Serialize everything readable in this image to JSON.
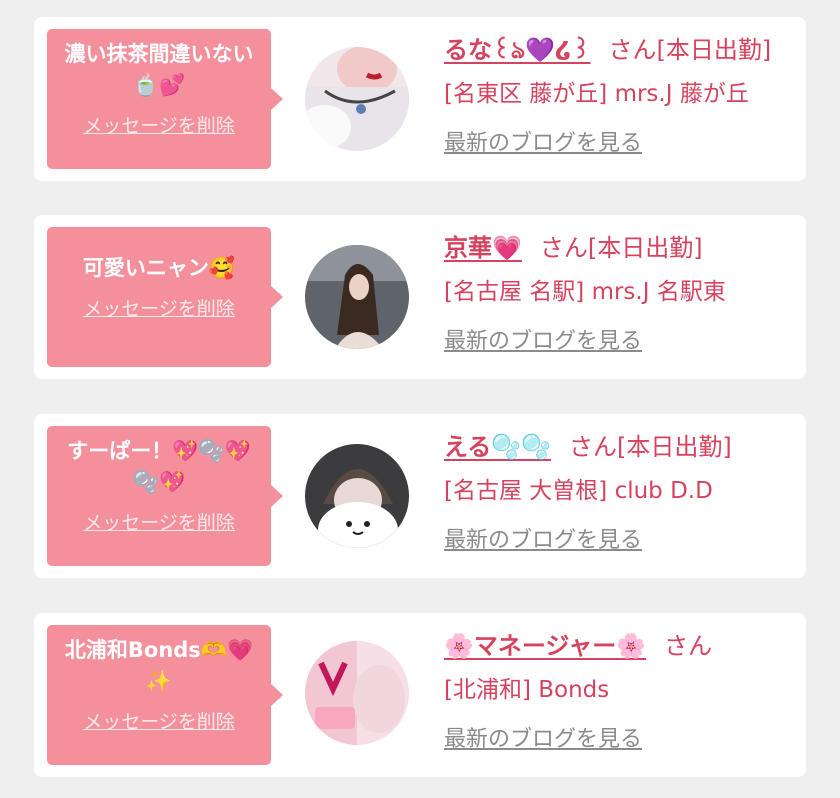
{
  "cards": [
    {
      "message": "濃い抹茶間違いない🍵💕",
      "delete_label": "メッセージを削除",
      "name": "るな꒰ঌ💜໒꒱",
      "honorific": "さん",
      "status": "[本日出勤]",
      "shop": "[名東区 藤が丘] mrs.J 藤が丘",
      "blog_label": "最新のブログを見る"
    },
    {
      "message": "可愛いニャン🥰",
      "delete_label": "メッセージを削除",
      "name": "京華💗",
      "honorific": "さん",
      "status": "[本日出勤]",
      "shop": "[名古屋 名駅] mrs.J 名駅東",
      "blog_label": "最新のブログを見る"
    },
    {
      "message": "すーぱー！💖🫧💖🫧💖",
      "delete_label": "メッセージを削除",
      "name": "える🫧🫧",
      "honorific": "さん",
      "status": "[本日出勤]",
      "shop": "[名古屋 大曽根] club D.D",
      "blog_label": "最新のブログを見る"
    },
    {
      "message": "北浦和Bonds🫶💗✨",
      "delete_label": "メッセージを削除",
      "name": "🌸マネージャー🌸",
      "honorific": "さん",
      "status": "",
      "shop": "[北浦和] Bonds",
      "blog_label": "最新のブログを見る"
    }
  ],
  "colors": {
    "bubble": "#f4909c",
    "accent_text": "#d5435f",
    "link_gray": "#8b8b8b",
    "page_bg": "#efefef"
  }
}
